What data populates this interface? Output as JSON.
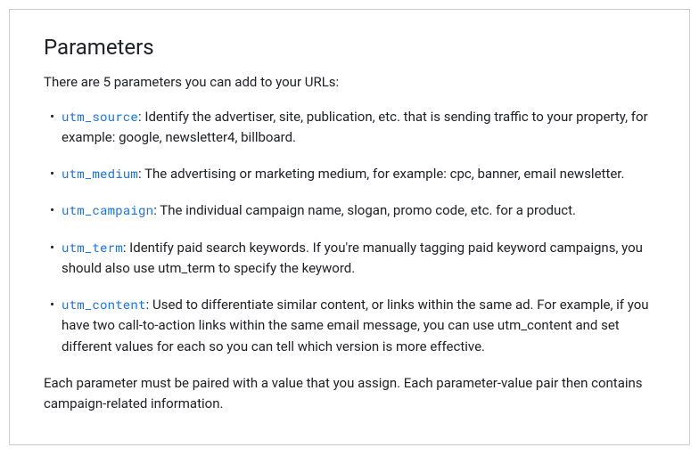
{
  "heading": "Parameters",
  "intro": "There are 5 parameters you can add to your URLs:",
  "parameters": [
    {
      "code": "utm_source",
      "description": ": Identify the advertiser, site, publication, etc. that is sending traffic to your property, for example: google, newsletter4, billboard."
    },
    {
      "code": "utm_medium",
      "description": ": The advertising or marketing medium, for example: cpc, banner, email newsletter."
    },
    {
      "code": "utm_campaign",
      "description": ": The individual campaign name, slogan, promo code, etc. for a product."
    },
    {
      "code": "utm_term",
      "description": ": Identify paid search keywords. If you're manually tagging paid keyword campaigns, you should also use utm_term to specify the keyword."
    },
    {
      "code": "utm_content",
      "description": ": Used to differentiate similar content, or links within the same ad. For example, if you have two call-to-action links within the same email message, you can use utm_content and set different values for each so you can tell which version is more effective."
    }
  ],
  "footer": "Each parameter must be paired with a value that you assign. Each parameter-value pair then contains campaign-related information."
}
